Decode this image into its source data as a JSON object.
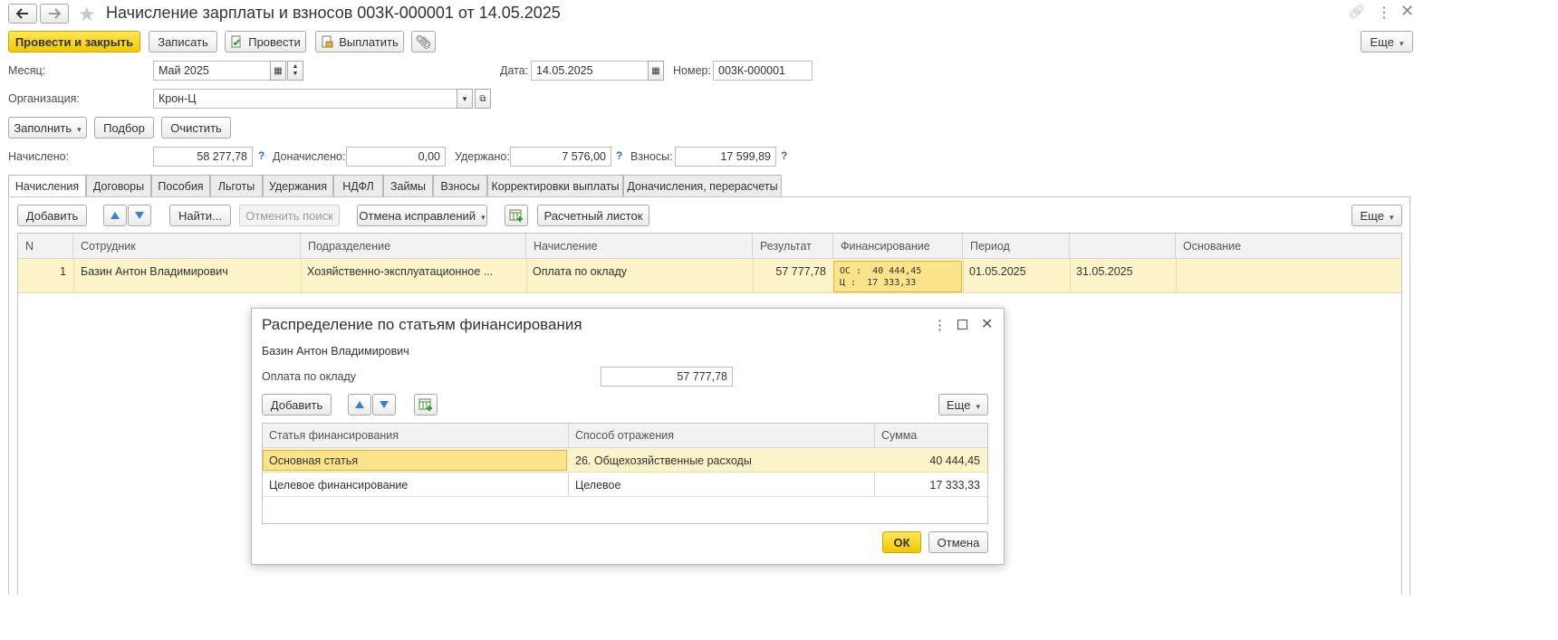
{
  "window": {
    "title": "Начисление зарплаты и взносов 003К-000001 от 14.05.2025"
  },
  "toolbar": {
    "post_close": "Провести и закрыть",
    "save": "Записать",
    "post": "Провести",
    "pay": "Выплатить",
    "more": "Еще"
  },
  "form": {
    "month_label": "Месяц:",
    "month_value": "Май 2025",
    "date_label": "Дата:",
    "date_value": "14.05.2025",
    "number_label": "Номер:",
    "number_value": "003К-000001",
    "org_label": "Организация:",
    "org_value": "Крон-Ц",
    "fill": "Заполнить",
    "pick": "Подбор",
    "clear": "Очистить",
    "accrued_label": "Начислено:",
    "accrued_value": "58 277,78",
    "extra_label": "Доначислено:",
    "extra_value": "0,00",
    "withheld_label": "Удержано:",
    "withheld_value": "7 576,00",
    "contrib_label": "Взносы:",
    "contrib_value": "17 599,89",
    "help": "?"
  },
  "tabs": [
    {
      "label": "Начисления"
    },
    {
      "label": "Договоры"
    },
    {
      "label": "Пособия"
    },
    {
      "label": "Льготы"
    },
    {
      "label": "Удержания"
    },
    {
      "label": "НДФЛ"
    },
    {
      "label": "Займы"
    },
    {
      "label": "Взносы"
    },
    {
      "label": "Корректировки выплаты"
    },
    {
      "label": "Доначисления, перерасчеты"
    }
  ],
  "table_toolbar": {
    "add": "Добавить",
    "find": "Найти...",
    "cancel_search": "Отменить поиск",
    "cancel_fixes": "Отмена исправлений",
    "payslip": "Расчетный листок",
    "more": "Еще"
  },
  "table": {
    "columns": [
      "N",
      "Сотрудник",
      "Подразделение",
      "Начисление",
      "Результат",
      "Финансирование",
      "Период",
      "",
      "Основание"
    ],
    "rows": [
      {
        "n": "1",
        "employee": "Базин Антон Владимирович",
        "department": "Хозяйственно-эксплуатационное ...",
        "accrual": "Оплата по окладу",
        "result": "57 777,78",
        "fin_line1": "ОС :  40 444,45",
        "fin_line2": "Ц :  17 333,33",
        "period_from": "01.05.2025",
        "period_to": "31.05.2025",
        "basis": ""
      }
    ]
  },
  "dialog": {
    "title": "Распределение по статьям финансирования",
    "employee": "Базин Антон Владимирович",
    "accrual_label": "Оплата по окладу",
    "accrual_amount": "57 777,78",
    "add": "Добавить",
    "more": "Еще",
    "columns": [
      "Статья финансирования",
      "Способ отражения",
      "Сумма"
    ],
    "rows": [
      {
        "article": "Основная статья",
        "method": "26. Общехозяйственные расходы",
        "sum": "40 444,45"
      },
      {
        "article": "Целевое финансирование",
        "method": "Целевое",
        "sum": "17 333,33"
      }
    ],
    "ok": "ОК",
    "cancel": "Отмена"
  },
  "colors": {
    "accent_yellow": "#f6d800",
    "row_highlight": "#fdf3c8",
    "cell_selected": "#fbe38a",
    "link_blue": "#2a6ebb"
  }
}
